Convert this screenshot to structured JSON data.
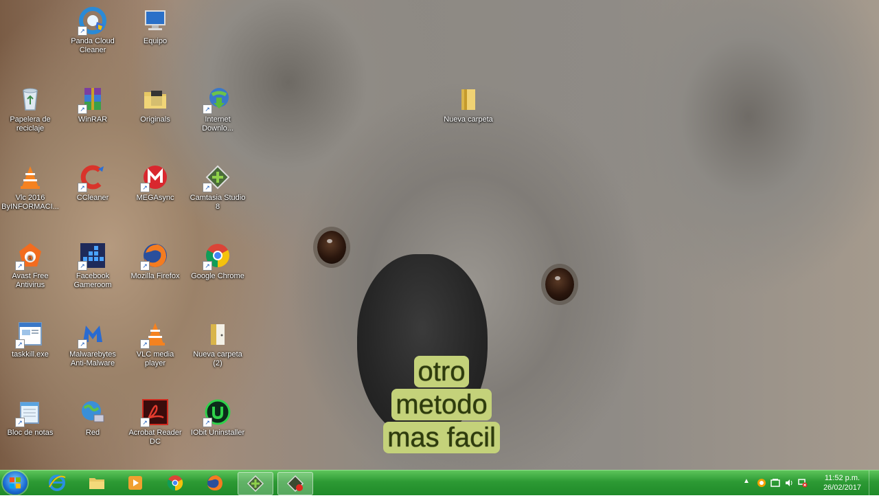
{
  "desktop_icons": [
    {
      "label": "Panda Cloud Cleaner",
      "icon": "panda-icon",
      "shortcut": true
    },
    {
      "label": "Equipo",
      "icon": "computer-icon",
      "shortcut": false
    },
    {
      "label": "Papelera de reciclaje",
      "icon": "recycle-bin-icon",
      "shortcut": false
    },
    {
      "label": "WinRAR",
      "icon": "winrar-icon",
      "shortcut": true
    },
    {
      "label": "Originals",
      "icon": "folder-icon",
      "shortcut": false
    },
    {
      "label": "Internet Downlo...",
      "icon": "internet-download-manager-icon",
      "shortcut": true
    },
    {
      "label": "Nueva carpeta",
      "icon": "folder-icon",
      "shortcut": false
    },
    {
      "label": "Vlc 2016 ByINFORMACI...",
      "icon": "vlc-icon",
      "shortcut": false
    },
    {
      "label": "CCleaner",
      "icon": "ccleaner-icon",
      "shortcut": true
    },
    {
      "label": "MEGAsync",
      "icon": "mega-icon",
      "shortcut": true
    },
    {
      "label": "Camtasia Studio 8",
      "icon": "camtasia-icon",
      "shortcut": true
    },
    {
      "label": "Avast Free Antivirus",
      "icon": "avast-icon",
      "shortcut": true
    },
    {
      "label": "Facebook Gameroom",
      "icon": "facebook-gameroom-icon",
      "shortcut": true
    },
    {
      "label": "Mozilla Firefox",
      "icon": "firefox-icon",
      "shortcut": true
    },
    {
      "label": "Google Chrome",
      "icon": "chrome-icon",
      "shortcut": true
    },
    {
      "label": "taskkill.exe",
      "icon": "exe-icon",
      "shortcut": true
    },
    {
      "label": "Malwarebytes Anti-Malware",
      "icon": "malwarebytes-icon",
      "shortcut": true
    },
    {
      "label": "VLC media player",
      "icon": "vlc-icon",
      "shortcut": true
    },
    {
      "label": "Nueva carpeta (2)",
      "icon": "folder-icon",
      "shortcut": false
    },
    {
      "label": "Bloc de notas",
      "icon": "notepad-icon",
      "shortcut": true
    },
    {
      "label": "Red",
      "icon": "network-icon",
      "shortcut": false
    },
    {
      "label": "Acrobat Reader DC",
      "icon": "acrobat-icon",
      "shortcut": true
    },
    {
      "label": "IObit Uninstaller",
      "icon": "iobit-uninstaller-icon",
      "shortcut": true
    }
  ],
  "overlay_text": [
    "otro",
    "metodo",
    "mas facil"
  ],
  "taskbar": {
    "start": "start-button",
    "pinned": [
      {
        "name": "internet-explorer",
        "icon": "internet-explorer-icon",
        "active": false
      },
      {
        "name": "file-explorer",
        "icon": "folder-icon",
        "active": false
      },
      {
        "name": "media-player",
        "icon": "media-player-icon",
        "active": false
      },
      {
        "name": "chrome",
        "icon": "chrome-icon",
        "active": false
      },
      {
        "name": "firefox",
        "icon": "firefox-icon",
        "active": false
      },
      {
        "name": "camtasia",
        "icon": "camtasia-icon",
        "active": true
      },
      {
        "name": "camtasia-recorder",
        "icon": "camtasia-recorder-icon",
        "active": true
      }
    ],
    "clock_time": "11:52 p.m.",
    "clock_date": "26/02/2017"
  },
  "colors": {
    "taskbar": "#2d9a34",
    "overlay_bg": "#c4d27a",
    "overlay_text": "#2e3c0c"
  }
}
